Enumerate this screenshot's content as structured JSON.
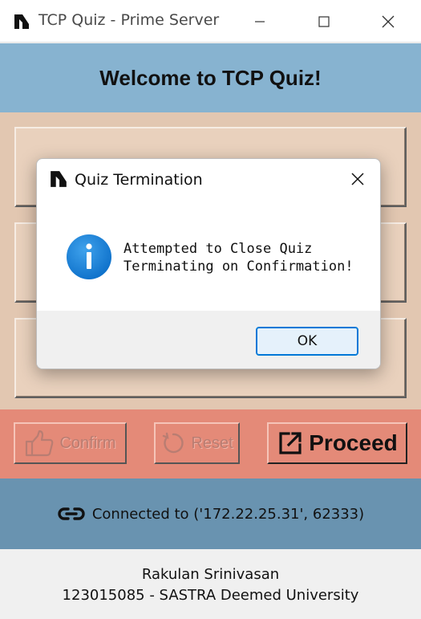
{
  "window": {
    "title": "TCP Quiz - Prime Server"
  },
  "header": {
    "title": "Welcome to TCP Quiz!"
  },
  "options": [
    {
      "label": ""
    },
    {
      "label": ""
    },
    {
      "label": ""
    }
  ],
  "actions": {
    "confirm_label": "Confirm",
    "reset_label": "Reset",
    "proceed_label": "Proceed"
  },
  "status": {
    "connection_text": "Connected to ('172.22.25.31', 62333)"
  },
  "footer": {
    "author": "Rakulan Srinivasan",
    "affiliation": "123015085 - SASTRA Deemed University"
  },
  "dialog": {
    "title": "Quiz Termination",
    "message_line1": "Attempted to Close Quiz",
    "message_line2": "Terminating on Confirmation!",
    "ok_label": "OK"
  },
  "colors": {
    "header_bg": "#87b3d0",
    "options_bg": "#e2c7b1",
    "action_bar_bg": "#e48a78",
    "status_bg": "#6993b0",
    "info_blue": "#1a7fd4",
    "ok_border": "#0078d7"
  },
  "icons": {
    "app": "app-logo-icon",
    "minimize": "minimize-icon",
    "maximize": "maximize-icon",
    "close": "close-icon",
    "confirm": "thumbs-up-icon",
    "reset": "reset-icon",
    "proceed": "external-link-icon",
    "status": "link-icon",
    "dialog_info": "info-icon"
  }
}
